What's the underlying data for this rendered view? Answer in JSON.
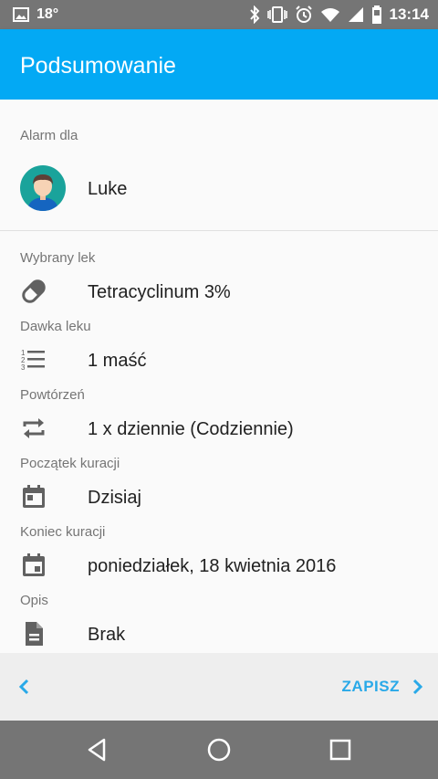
{
  "status_bar": {
    "temperature": "18°",
    "time": "13:14",
    "icons": [
      "image-icon",
      "bluetooth-icon",
      "vibrate-icon",
      "alarm-icon",
      "wifi-icon",
      "signal-icon",
      "battery-icon"
    ]
  },
  "app_bar": {
    "title": "Podsumowanie",
    "color": "#03a9f4"
  },
  "alarm": {
    "label": "Alarm dla",
    "user_name": "Luke"
  },
  "details": [
    {
      "label": "Wybrany lek",
      "value": "Tetracyclinum 3%",
      "icon": "pill-icon"
    },
    {
      "label": "Dawka leku",
      "value": "1 maść",
      "icon": "numbered-list-icon"
    },
    {
      "label": "Powtórzeń",
      "value": "1 x dziennie (Codziennie)",
      "icon": "repeat-icon"
    },
    {
      "label": "Początek kuracji",
      "value": "Dzisiaj",
      "icon": "calendar-icon"
    },
    {
      "label": "Koniec kuracji",
      "value": "poniedziałek, 18 kwietnia 2016",
      "icon": "calendar-end-icon"
    },
    {
      "label": "Opis",
      "value": "Brak",
      "icon": "description-icon"
    }
  ],
  "actions": {
    "save_label": "ZAPISZ",
    "accent": "#29a9e8"
  },
  "nav": [
    "back-nav-icon",
    "home-nav-icon",
    "recents-nav-icon"
  ]
}
